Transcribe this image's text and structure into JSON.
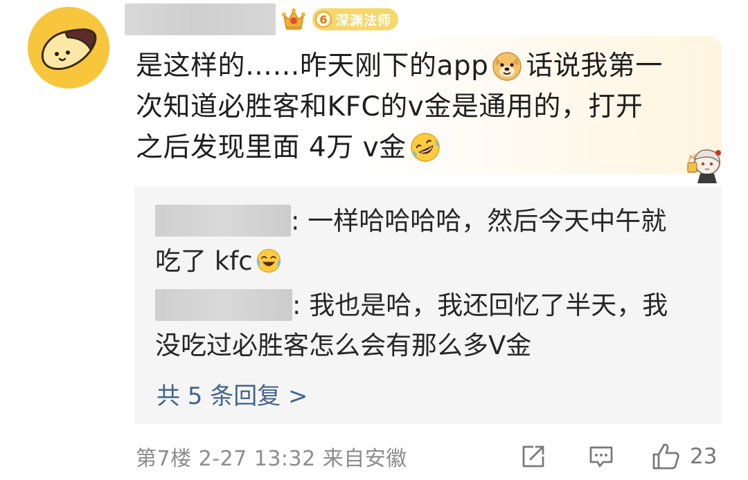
{
  "post": {
    "level": "6",
    "level_title": "深渊法师",
    "comment": {
      "line1_a": "是这样的……昨天刚下的app",
      "line1_b": "话说我第一",
      "line2": "次知道必胜客和KFC的v金是通用的，打开",
      "line3": "之后发现里面 4万 v金"
    },
    "replies": [
      {
        "text_a": ": 一样哈哈哈哈，然后今天中午就",
        "text_b": "吃了 kfc"
      },
      {
        "text_a": ": 我也是哈，我还回忆了半天，我",
        "text_b": "没吃过必胜客怎么会有那么多V金"
      }
    ],
    "more_replies": "共 5 条回复 >",
    "meta": "第7楼  2-27 13:32  来自安徽",
    "like_count": "23"
  },
  "colors": {
    "avatar_bg": "#f7c63c",
    "badge_bg": "#f6d76b",
    "link": "#41648f",
    "meta": "#8c8c8c",
    "reply_bg": "#f5f5f5"
  },
  "icons": {
    "avatar": "sweet-potato-avatar",
    "crown": "crown-badge-icon",
    "emoji_1": "doge-emoji",
    "emoji_2": "rofl-emoji",
    "emoji_3": "laughing-crying-emoji",
    "sticker": "anime-character-sticker",
    "share": "share-icon",
    "comment": "comment-icon",
    "like": "thumb-up-icon"
  }
}
